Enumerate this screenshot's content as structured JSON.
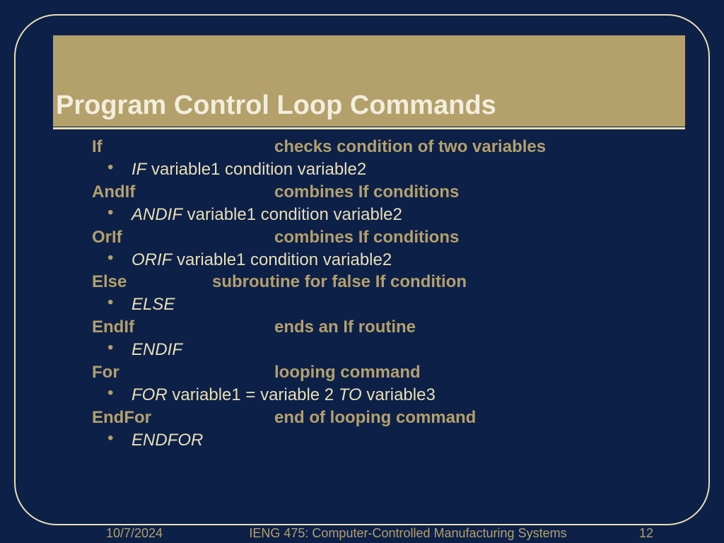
{
  "title": "Program Control Loop Commands",
  "items": [
    {
      "cmd": "If",
      "desc": "checks condition of two variables",
      "kw": "IF",
      "args": " variable1 condition variable2",
      "narrow": false
    },
    {
      "cmd": "AndIf",
      "desc": "combines If conditions",
      "kw": "ANDIF",
      "args": " variable1 condition variable2",
      "narrow": false
    },
    {
      "cmd": "OrIf",
      "desc": "combines If conditions",
      "kw": "ORIF",
      "args": " variable1 condition variable2",
      "narrow": false
    },
    {
      "cmd": "Else",
      "desc": "subroutine for false If condition",
      "kw": "ELSE",
      "args": "",
      "narrow": true
    },
    {
      "cmd": "EndIf",
      "desc": "ends an If routine",
      "kw": "ENDIF",
      "args": "",
      "narrow": false
    },
    {
      "cmd": "For",
      "desc": "looping command",
      "kw": "FOR",
      "args": " variable1 = variable 2 ",
      "kw2": "TO",
      "args2": " variable3",
      "narrow": false
    },
    {
      "cmd": "EndFor",
      "desc": "end of looping command",
      "kw": "ENDFOR",
      "args": "",
      "narrow": false
    }
  ],
  "footer": {
    "date": "10/7/2024",
    "course": "IENG 475: Computer-Controlled Manufacturing Systems",
    "page": "12"
  }
}
